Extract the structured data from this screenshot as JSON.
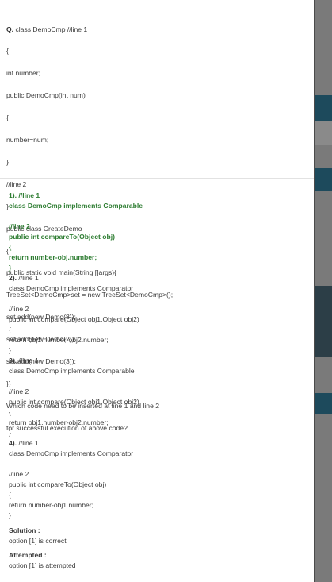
{
  "question": {
    "prefix": "Q.",
    "lines": [
      " class DemoCmp //line 1",
      "{",
      "int number;",
      "public DemoCmp(int num)",
      "{",
      "number=num;",
      "}",
      "//line 2",
      "}",
      "public class CreateDemo",
      "{",
      "public static void main(String []args){",
      "TreeSet<DemoCmp>set = new TreeSet<DemoCmp>();",
      "set.add(new Demo(8));",
      "set.add(new Demo(2));",
      "set.add(new Demo(3));",
      "}}",
      "Which code need to be inserted at line 1 and line 2",
      "for successful execution of above code?"
    ]
  },
  "options": [
    {
      "number": "1).",
      "correct": true,
      "lines": [
        " //line 1",
        "class DemoCmp implements Comparable",
        "",
        "//line 2",
        "public int compareTo(Object obj)",
        "{",
        "return number-obj.number;",
        "}"
      ]
    },
    {
      "number": "2).",
      "correct": false,
      "lines": [
        " //line 1",
        "class DemoCmp implements Comparator",
        "",
        "//line 2",
        "public int compare(Object obj1,Object obj2)",
        "{",
        "return obj1.number-obj2.number;",
        "}"
      ]
    },
    {
      "number": "3).",
      "correct": false,
      "lines": [
        " //line 1",
        "class DemoCmp implements Comparable",
        "",
        "//line 2",
        "public int compare(Object obj1,Object obj2)",
        "{",
        "return obj1.number-obj2.number;",
        "}"
      ]
    },
    {
      "number": "4).",
      "correct": false,
      "lines": [
        " //line 1",
        "class DemoCmp implements Comparator",
        "",
        "//line 2",
        "public int compareTo(Object obj)",
        "{",
        "return number-obj1.number;",
        "}"
      ]
    }
  ],
  "solution": {
    "label": "Solution :",
    "text": "option [1] is correct"
  },
  "attempted": {
    "label": "Attempted :",
    "text": "option [1] is attempted"
  }
}
